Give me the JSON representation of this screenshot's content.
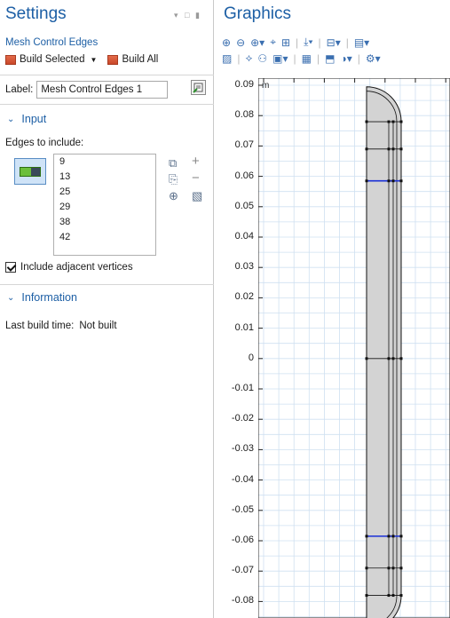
{
  "settings": {
    "title": "Settings",
    "subtitle": "Mesh Control Edges",
    "build_selected": "Build Selected",
    "build_all": "Build All",
    "label_caption": "Label:",
    "label_value": "Mesh Control Edges 1"
  },
  "input_section": {
    "heading": "Input",
    "edges_label": "Edges to include:",
    "edges": [
      "9",
      "13",
      "25",
      "29",
      "38",
      "42"
    ],
    "adjacent_vertices_label": "Include adjacent vertices"
  },
  "information_section": {
    "heading": "Information",
    "last_build_label": "Last build time:",
    "last_build_value": "Not built"
  },
  "graphics": {
    "title": "Graphics",
    "unit": "m",
    "y_ticks": [
      "0.09",
      "0.08",
      "0.07",
      "0.06",
      "0.05",
      "0.04",
      "0.03",
      "0.02",
      "0.01",
      "0",
      "-0.01",
      "-0.02",
      "-0.03",
      "-0.04",
      "-0.05",
      "-0.06",
      "-0.07",
      "-0.08"
    ]
  },
  "colors": {
    "accent": "#1d5fa5",
    "grid": "#cfe0f1",
    "geometry_fill": "#d3d3d3",
    "selected_edge": "#1a2fd6"
  }
}
